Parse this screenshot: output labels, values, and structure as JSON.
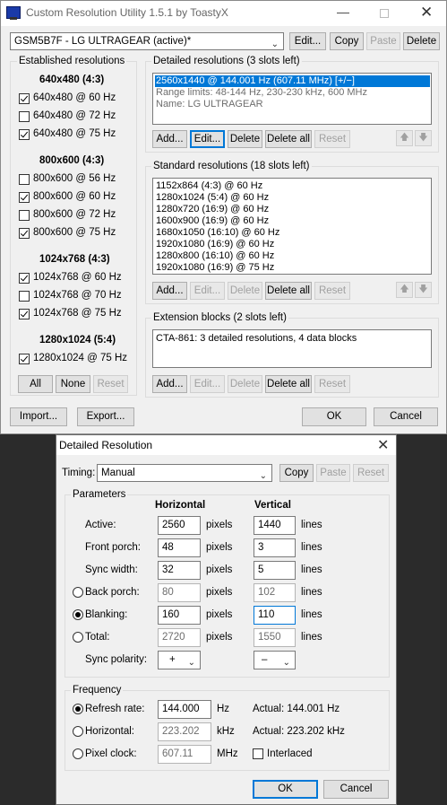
{
  "main": {
    "title": "Custom Resolution Utility 1.5.1 by ToastyX",
    "monitor": "GSM5B7F - LG ULTRAGEAR (active)*",
    "top_buttons": {
      "edit": "Edit...",
      "copy": "Copy",
      "paste": "Paste",
      "delete": "Delete"
    },
    "established": {
      "title": "Established resolutions",
      "groups": [
        {
          "label": "640x480 (4:3)",
          "items": [
            {
              "label": "640x480 @ 60 Hz",
              "checked": true
            },
            {
              "label": "640x480 @ 72 Hz",
              "checked": false
            },
            {
              "label": "640x480 @ 75 Hz",
              "checked": true
            }
          ]
        },
        {
          "label": "800x600 (4:3)",
          "items": [
            {
              "label": "800x600 @ 56 Hz",
              "checked": false
            },
            {
              "label": "800x600 @ 60 Hz",
              "checked": true
            },
            {
              "label": "800x600 @ 72 Hz",
              "checked": false
            },
            {
              "label": "800x600 @ 75 Hz",
              "checked": true
            }
          ]
        },
        {
          "label": "1024x768 (4:3)",
          "items": [
            {
              "label": "1024x768 @ 60 Hz",
              "checked": true
            },
            {
              "label": "1024x768 @ 70 Hz",
              "checked": false
            },
            {
              "label": "1024x768 @ 75 Hz",
              "checked": true
            }
          ]
        },
        {
          "label": "1280x1024 (5:4)",
          "items": [
            {
              "label": "1280x1024 @ 75 Hz",
              "checked": true
            }
          ]
        }
      ],
      "buttons": {
        "all": "All",
        "none": "None",
        "reset": "Reset"
      }
    },
    "detailed": {
      "title": "Detailed resolutions (3 slots left)",
      "items": [
        "2560x1440 @ 144.001 Hz (607.11 MHz) [+/−]",
        "Range limits: 48-144 Hz, 230-230 kHz, 600 MHz",
        "Name: LG ULTRAGEAR"
      ],
      "buttons": {
        "add": "Add...",
        "edit": "Edit...",
        "delete": "Delete",
        "delete_all": "Delete all",
        "reset": "Reset"
      }
    },
    "standard": {
      "title": "Standard resolutions (18 slots left)",
      "items": [
        "1152x864 (4:3) @ 60 Hz",
        "1280x1024 (5:4) @ 60 Hz",
        "1280x720 (16:9) @ 60 Hz",
        "1600x900 (16:9) @ 60 Hz",
        "1680x1050 (16:10) @ 60 Hz",
        "1920x1080 (16:9) @ 60 Hz",
        "1280x800 (16:10) @ 60 Hz",
        "1920x1080 (16:9) @ 75 Hz"
      ],
      "buttons": {
        "add": "Add...",
        "edit": "Edit...",
        "delete": "Delete",
        "delete_all": "Delete all",
        "reset": "Reset"
      }
    },
    "extension": {
      "title": "Extension blocks (2 slots left)",
      "items": [
        "CTA-861: 3 detailed resolutions, 4 data blocks"
      ],
      "buttons": {
        "add": "Add...",
        "edit": "Edit...",
        "delete": "Delete",
        "delete_all": "Delete all",
        "reset": "Reset"
      }
    },
    "bottom_buttons": {
      "import": "Import...",
      "export": "Export...",
      "ok": "OK",
      "cancel": "Cancel"
    }
  },
  "dialog": {
    "title": "Detailed Resolution",
    "timing_label": "Timing:",
    "timing_value": "Manual",
    "timing_buttons": {
      "copy": "Copy",
      "paste": "Paste",
      "reset": "Reset"
    },
    "parameters_title": "Parameters",
    "col_horizontal": "Horizontal",
    "col_vertical": "Vertical",
    "rows": [
      {
        "label": "Active:",
        "h": "2560",
        "v": "1440",
        "h_unit": "pixels",
        "v_unit": "lines"
      },
      {
        "label": "Front porch:",
        "h": "48",
        "v": "3",
        "h_unit": "pixels",
        "v_unit": "lines"
      },
      {
        "label": "Sync width:",
        "h": "32",
        "v": "5",
        "h_unit": "pixels",
        "v_unit": "lines"
      },
      {
        "label": "Back porch:",
        "h": "80",
        "v": "102",
        "h_unit": "pixels",
        "v_unit": "lines"
      },
      {
        "label": "Blanking:",
        "h": "160",
        "v": "110",
        "h_unit": "pixels",
        "v_unit": "lines"
      },
      {
        "label": "Total:",
        "h": "2720",
        "v": "1550",
        "h_unit": "pixels",
        "v_unit": "lines"
      }
    ],
    "sync_polarity_label": "Sync polarity:",
    "sync_h": "+",
    "sync_v": "–",
    "frequency_title": "Frequency",
    "refresh_label": "Refresh rate:",
    "refresh_value": "144.000",
    "refresh_unit": "Hz",
    "refresh_actual": "Actual: 144.001 Hz",
    "horizontal_label": "Horizontal:",
    "horizontal_value": "223.202",
    "horizontal_unit": "kHz",
    "horizontal_actual": "Actual: 223.202 kHz",
    "pixel_label": "Pixel clock:",
    "pixel_value": "607.11",
    "pixel_unit": "MHz",
    "interlaced_label": "Interlaced",
    "ok": "OK",
    "cancel": "Cancel"
  }
}
